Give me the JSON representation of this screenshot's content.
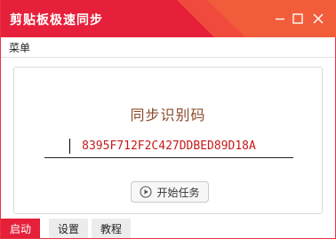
{
  "window": {
    "title": "剪贴板极速同步",
    "controls": [
      "minimize-icon",
      "maximize-icon",
      "close-icon"
    ],
    "accent_color": "#e6203a"
  },
  "menubar": {
    "menu_label": "菜单"
  },
  "main": {
    "heading": "同步识别码",
    "code_value": "8395F712F2C427DDBED89D18A",
    "start_button": {
      "label": "开始任务",
      "icon": "play-circle-icon"
    }
  },
  "tabs": [
    {
      "label": "启动",
      "active": true
    },
    {
      "label": "设置",
      "active": false
    },
    {
      "label": "教程",
      "active": false
    }
  ]
}
